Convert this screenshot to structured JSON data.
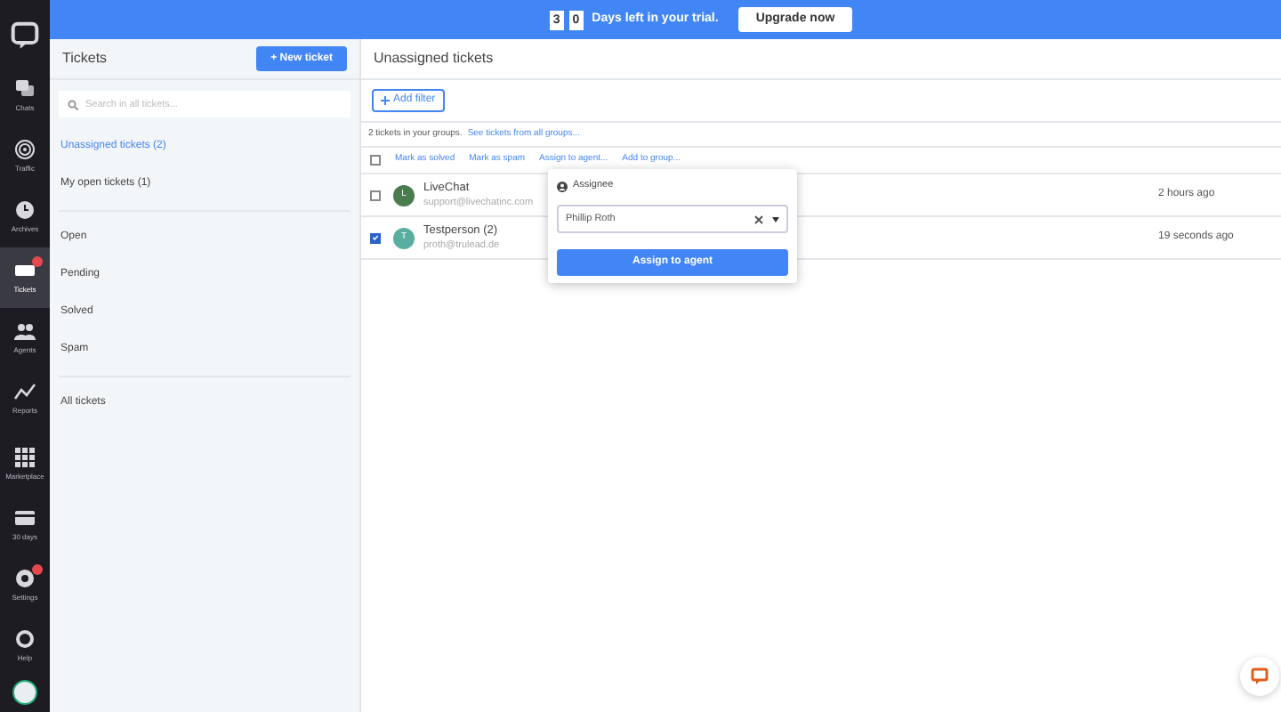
{
  "nav": {
    "top": [
      {
        "kind": "logo",
        "selected": false
      },
      {
        "kind": "chats",
        "label": "Chats",
        "selected": false
      },
      {
        "kind": "traffic",
        "label": "Traffic",
        "selected": false
      },
      {
        "kind": "archives",
        "label": "Archives",
        "selected": false
      },
      {
        "kind": "tickets",
        "label": "Tickets",
        "selected": true,
        "badge": true
      },
      {
        "kind": "agents",
        "label": "Agents",
        "selected": false
      },
      {
        "kind": "reports",
        "label": "Reports",
        "selected": false
      }
    ],
    "bottom": [
      {
        "kind": "marketplace",
        "label": "Marketplace",
        "selected": false,
        "badge": false
      },
      {
        "kind": "days",
        "label": "30 days",
        "selected": false,
        "badge": false
      },
      {
        "kind": "settings",
        "label": "Settings",
        "selected": false,
        "badge": true
      },
      {
        "kind": "help",
        "label": "Help",
        "selected": false,
        "badge": false
      }
    ]
  },
  "trial": {
    "digits": [
      "3",
      "0"
    ],
    "text": "Days left in your trial.",
    "button": "Upgrade now"
  },
  "tickets_panel": {
    "title": "Tickets",
    "new_button": "+ New ticket",
    "search": {
      "placeholder": "Search in all tickets..."
    },
    "groups": [
      [
        {
          "label": "Unassigned tickets (2)",
          "selected": true
        },
        {
          "label": "My open tickets (1)",
          "selected": false
        }
      ],
      [
        {
          "label": "Open",
          "selected": false
        },
        {
          "label": "Pending",
          "selected": false
        },
        {
          "label": "Solved",
          "selected": false
        },
        {
          "label": "Spam",
          "selected": false
        }
      ],
      [
        {
          "label": "All tickets",
          "selected": false
        }
      ]
    ]
  },
  "main": {
    "title": "Unassigned tickets",
    "add_filter": "Add filter",
    "info": "2 tickets in your groups.",
    "info_link": "See tickets from all groups...",
    "select_all": {
      "checked": false
    },
    "actions": [
      "Mark as solved",
      "Mark as spam",
      "Assign to agent...",
      "Add to group..."
    ],
    "rows": [
      {
        "initial": "L",
        "color": "#4a7c4e",
        "name": "LiveChat",
        "email": "support@livechatinc.com",
        "time": "2 hours ago",
        "checked": false
      },
      {
        "initial": "T",
        "color": "#5aaea0",
        "name": "Testperson (2)",
        "email": "proth@trulead.de",
        "time": "19 seconds ago",
        "checked": true
      }
    ]
  },
  "popup": {
    "title": "Assignee",
    "value": "Phillip Roth",
    "button": "Assign to agent"
  }
}
